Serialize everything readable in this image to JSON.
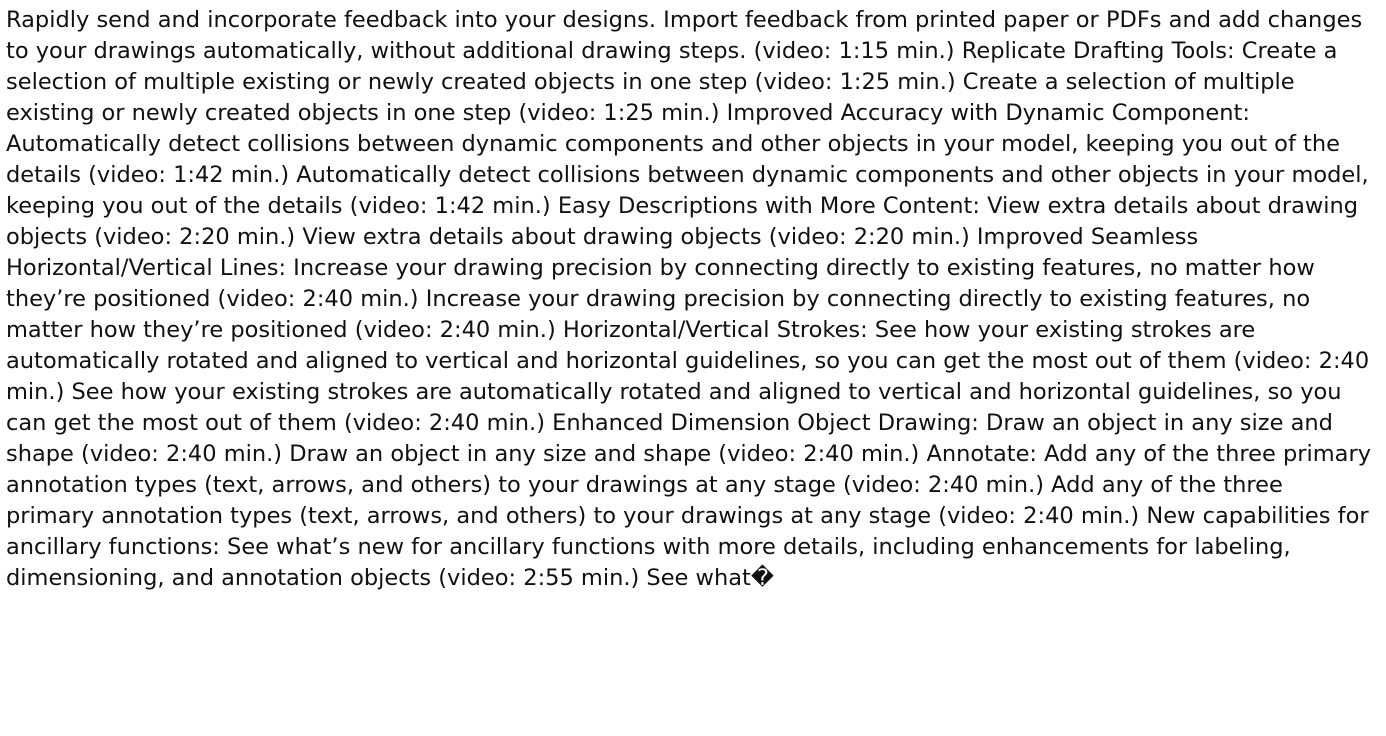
{
  "document": {
    "paragraph": "Rapidly send and incorporate feedback into your designs. Import feedback from printed paper or PDFs and add changes to your drawings automatically, without additional drawing steps. (video: 1:15 min.) Replicate Drafting Tools: Create a selection of multiple existing or newly created objects in one step (video: 1:25 min.) Create a selection of multiple existing or newly created objects in one step (video: 1:25 min.) Improved Accuracy with Dynamic Component: Automatically detect collisions between dynamic components and other objects in your model, keeping you out of the details (video: 1:42 min.) Automatically detect collisions between dynamic components and other objects in your model, keeping you out of the details (video: 1:42 min.) Easy Descriptions with More Content: View extra details about drawing objects (video: 2:20 min.) View extra details about drawing objects (video: 2:20 min.) Improved Seamless Horizontal/Vertical Lines: Increase your drawing precision by connecting directly to existing features, no matter how they’re positioned (video: 2:40 min.) Increase your drawing precision by connecting directly to existing features, no matter how they’re positioned (video: 2:40 min.) Horizontal/Vertical Strokes: See how your existing strokes are automatically rotated and aligned to vertical and horizontal guidelines, so you can get the most out of them (video: 2:40 min.) See how your existing strokes are automatically rotated and aligned to vertical and horizontal guidelines, so you can get the most out of them (video: 2:40 min.) Enhanced Dimension Object Drawing: Draw an object in any size and shape (video: 2:40 min.) Draw an object in any size and shape (video: 2:40 min.) Annotate: Add any of the three primary annotation types (text, arrows, and others) to your drawings at any stage (video: 2:40 min.) Add any of the three primary annotation types (text, arrows, and others) to your drawings at any stage (video: 2:40 min.) New capabilities for ancillary functions: See what’s new for ancillary functions with more details, including enhancements for labeling, dimensioning, and annotation objects (video: 2:55 min.) See what�"
  }
}
